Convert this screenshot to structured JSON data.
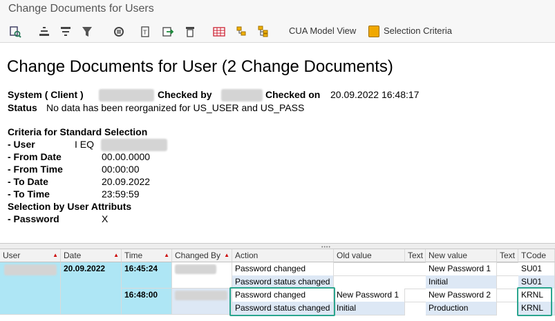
{
  "window": {
    "title": "Change Documents for Users"
  },
  "toolbar": {
    "cua_label": "CUA Model View",
    "criteria_label": "Selection Criteria"
  },
  "report": {
    "heading": "Change Documents for User (2 Change Documents)",
    "system_label": "System ( Client )",
    "checked_by_label": "Checked by",
    "checked_on_label": "Checked on",
    "checked_on_value": "20.09.2022 16:48:17",
    "status_label": "Status",
    "status_value": "No data has been reorganized for US_USER and US_PASS",
    "criteria_title": "Criteria for Standard Selection",
    "criteria": [
      {
        "label": "- User",
        "value": "I EQ"
      },
      {
        "label": "- From Date",
        "value": "00.00.0000"
      },
      {
        "label": "- From Time",
        "value": "00:00:00"
      },
      {
        "label": "- To Date",
        "value": "20.09.2022"
      },
      {
        "label": "- To Time",
        "value": "23:59:59"
      }
    ],
    "attr_title": "Selection by User Attributs",
    "attr": {
      "label": "- Password",
      "value": "X"
    }
  },
  "table": {
    "headers": [
      "User",
      "Date",
      "Time",
      "Changed By",
      "Action",
      "Old value",
      "Text",
      "New value",
      "Text",
      "TCode"
    ],
    "date": "20.09.2022",
    "rows": [
      {
        "time": "16:45:24",
        "action": "Password changed",
        "old": "",
        "new": "New Password  1",
        "tcode": "SU01"
      },
      {
        "time": "",
        "action": "Password status changed",
        "old": "",
        "new": "Initial",
        "tcode": "SU01"
      },
      {
        "time": "16:48:00",
        "action": "Password changed",
        "old": "New Password  1",
        "new": "New Password  2",
        "tcode": "KRNL"
      },
      {
        "time": "",
        "action": "Password status changed",
        "old": "Initial",
        "new": "Production",
        "tcode": "KRNL"
      }
    ]
  },
  "colors": {
    "highlight": "#2aa58e",
    "group_cell": "#aee6f5",
    "row_alt": "#dde8f5"
  }
}
